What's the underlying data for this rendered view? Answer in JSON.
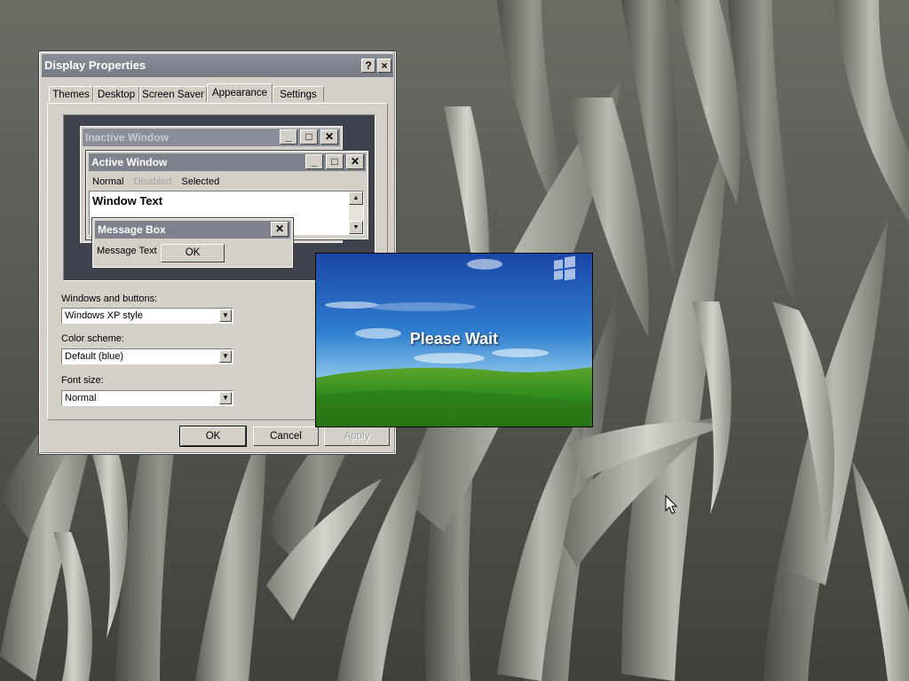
{
  "dialog": {
    "title": "Display Properties",
    "help_glyph": "?",
    "close_glyph": "×",
    "tabs": [
      {
        "label": "Themes"
      },
      {
        "label": "Desktop"
      },
      {
        "label": "Screen Saver"
      },
      {
        "label": "Appearance",
        "active": true
      },
      {
        "label": "Settings"
      }
    ],
    "preview": {
      "inactive_window_title": "Inactive Window",
      "active_window_title": "Active Window",
      "menu_normal": "Normal",
      "menu_disabled": "Disabled",
      "menu_selected": "Selected",
      "window_text": "Window Text",
      "message_box_title": "Message Box",
      "message_text": "Message Text",
      "message_ok": "OK",
      "minimize_glyph": "_",
      "maximize_glyph": "□",
      "close_glyph": "✕"
    },
    "windows_buttons_label": "Windows and buttons:",
    "windows_buttons_value": "Windows XP style",
    "color_scheme_label": "Color scheme:",
    "color_scheme_value": "Default (blue)",
    "font_size_label": "Font size:",
    "font_size_value": "Normal",
    "ok_label": "OK",
    "cancel_label": "Cancel",
    "apply_label": "Apply"
  },
  "splash": {
    "text": "Please Wait"
  },
  "colors": {
    "inactive_title": "#8a8e98",
    "active_title": "#7e828c",
    "preview_bg": "#3d424d",
    "face": "#d4d0c8"
  }
}
